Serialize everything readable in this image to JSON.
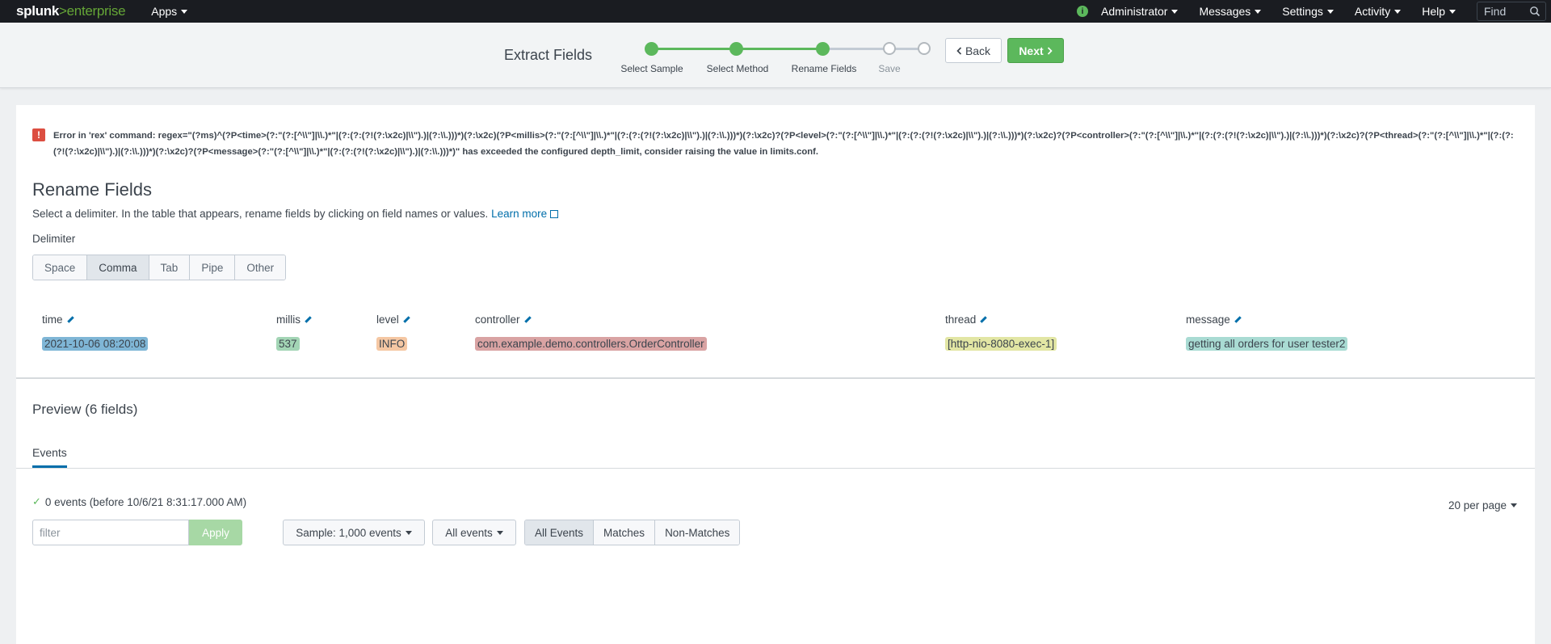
{
  "topbar": {
    "logo_bold": "splunk",
    "logo_gt": ">",
    "logo_product": "enterprise",
    "apps_label": "Apps",
    "info_glyph": "i",
    "admin_label": "Administrator",
    "messages_label": "Messages",
    "settings_label": "Settings",
    "activity_label": "Activity",
    "help_label": "Help",
    "find_placeholder": "Find"
  },
  "wizard": {
    "title": "Extract Fields",
    "steps": [
      {
        "label": "Select Sample",
        "state": "done"
      },
      {
        "label": "Select Method",
        "state": "done"
      },
      {
        "label": "Rename Fields",
        "state": "done"
      },
      {
        "label": "Save",
        "state": "todo"
      },
      {
        "label": "",
        "state": "todo"
      }
    ],
    "back_label": "Back",
    "next_label": "Next"
  },
  "error": {
    "icon_glyph": "!",
    "message": "Error in 'rex' command: regex=\"(?ms)^(?P<time>(?:\"(?:[^\\\\\"]|\\\\.)*\"|(?:(?:(?!(?:\\x2c)|\\\\\").)|(?:\\\\.)))*)(?:\\x2c)(?P<millis>(?:\"(?:[^\\\\\"]|\\\\.)*\"|(?:(?:(?!(?:\\x2c)|\\\\\").)|(?:\\\\.)))*)(?:\\x2c)?(?P<level>(?:\"(?:[^\\\\\"]|\\\\.)*\"|(?:(?:(?!(?:\\x2c)|\\\\\").)|(?:\\\\.)))*)(?:\\x2c)?(?P<controller>(?:\"(?:[^\\\\\"]|\\\\.)*\"|(?:(?:(?!(?:\\x2c)|\\\\\").)|(?:\\\\.)))*)(?:\\x2c)?(?P<thread>(?:\"(?:[^\\\\\"]|\\\\.)*\"|(?:(?:(?!(?:\\x2c)|\\\\\").)|(?:\\\\.)))*)(?:\\x2c)?(?P<message>(?:\"(?:[^\\\\\"]|\\\\.)*\"|(?:(?:(?!(?:\\x2c)|\\\\\").)|(?:\\\\.)))*)\" has exceeded the configured depth_limit, consider raising the value in limits.conf."
  },
  "rename": {
    "heading": "Rename Fields",
    "description": "Select a delimiter. In the table that appears, rename fields by clicking on field names or values.",
    "learn_more": "Learn more",
    "delimiter_label": "Delimiter",
    "delimiters": [
      "Space",
      "Comma",
      "Tab",
      "Pipe",
      "Other"
    ],
    "selected_delimiter": "Comma"
  },
  "fields": [
    {
      "name": "time",
      "value": "2021-10-06 08:20:08",
      "color": "#7fb6d6"
    },
    {
      "name": "millis",
      "value": "537",
      "color": "#a3d5b5"
    },
    {
      "name": "level",
      "value": "INFO",
      "color": "#f5c7a3"
    },
    {
      "name": "controller",
      "value": "com.example.demo.controllers.OrderController",
      "color": "#d9a3a3"
    },
    {
      "name": "thread",
      "value": "[http-nio-8080-exec-1]",
      "color": "#e2e6a4"
    },
    {
      "name": "message",
      "value": "getting all orders for user tester2",
      "color": "#a9dbd3"
    }
  ],
  "preview": {
    "heading": "Preview (6 fields)",
    "tab_events": "Events",
    "event_count": "0 events (before 10/6/21 8:31:17.000 AM)",
    "per_page": "20 per page",
    "filter_placeholder": "filter",
    "apply_label": "Apply",
    "sample_label": "Sample: 1,000 events",
    "all_events_dd": "All events",
    "match_options": [
      "All Events",
      "Matches",
      "Non-Matches"
    ],
    "selected_match": "All Events"
  }
}
